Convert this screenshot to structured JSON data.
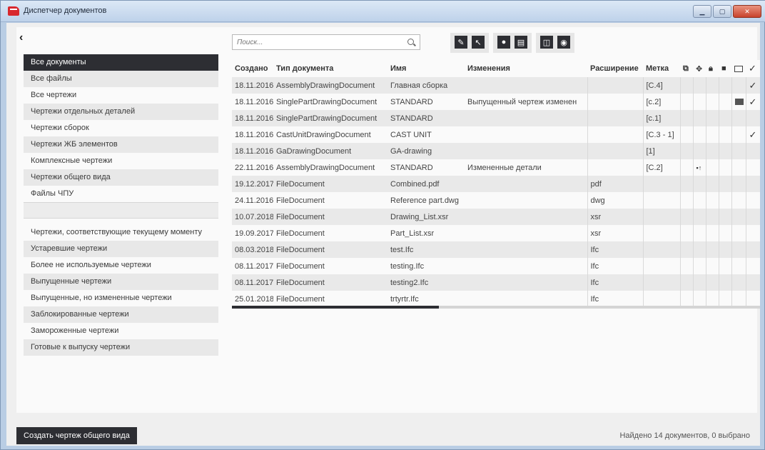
{
  "window": {
    "title": "Диспетчер документов"
  },
  "sidebar": {
    "back": "‹",
    "items_top": [
      "Все документы",
      "Все файлы",
      "Все чертежи",
      "Чертежи отдельных деталей",
      "Чертежи сборок",
      "Чертежи ЖБ элементов",
      "Комплексные чертежи",
      "Чертежи общего вида",
      "Файлы ЧПУ"
    ],
    "items_bottom": [
      "Чертежи, соответствующие текущему моменту",
      "Устаревшие чертежи",
      "Более не используемые чертежи",
      "Выпущенные чертежи",
      "Выпущенные, но измененные чертежи",
      "Заблокированные чертежи",
      "Замороженные чертежи",
      "Готовые к выпуску чертежи"
    ]
  },
  "search": {
    "placeholder": "Поиск..."
  },
  "table": {
    "headers": [
      "Создано",
      "Тип документа",
      "Имя",
      "Изменения",
      "Расширение",
      "Метка"
    ],
    "rows": [
      {
        "created": "18.11.2016",
        "type": "AssemblyDrawingDocument",
        "name": "Главная сборка",
        "changes": "",
        "ext": "",
        "mark": "[C.4]",
        "flag": "",
        "mail": false,
        "check": true
      },
      {
        "created": "18.11.2016",
        "type": "SinglePartDrawingDocument",
        "name": "STANDARD",
        "changes": "Выпущенный чертеж изменен",
        "ext": "",
        "mark": "[c.2]",
        "flag": "",
        "mail": true,
        "check": true
      },
      {
        "created": "18.11.2016",
        "type": "SinglePartDrawingDocument",
        "name": "STANDARD",
        "changes": "",
        "ext": "",
        "mark": "[c.1]",
        "flag": "",
        "mail": false,
        "check": false
      },
      {
        "created": "18.11.2016",
        "type": "CastUnitDrawingDocument",
        "name": "CAST UNIT",
        "changes": "",
        "ext": "",
        "mark": "[C.3 - 1]",
        "flag": "",
        "mail": false,
        "check": true
      },
      {
        "created": "18.11.2016",
        "type": "GaDrawingDocument",
        "name": "GA-drawing",
        "changes": "",
        "ext": "",
        "mark": "[1]",
        "flag": "",
        "mail": false,
        "check": false
      },
      {
        "created": "22.11.2016",
        "type": "AssemblyDrawingDocument",
        "name": "STANDARD",
        "changes": "Измененные детали",
        "ext": "",
        "mark": "[C.2]",
        "flag": "▪↑",
        "mail": false,
        "check": false
      },
      {
        "created": "19.12.2017",
        "type": "FileDocument",
        "name": "Combined.pdf",
        "changes": "",
        "ext": "pdf",
        "mark": "",
        "flag": "",
        "mail": false,
        "check": false
      },
      {
        "created": "24.11.2016",
        "type": "FileDocument",
        "name": "Reference part.dwg",
        "changes": "",
        "ext": "dwg",
        "mark": "",
        "flag": "",
        "mail": false,
        "check": false
      },
      {
        "created": "10.07.2018",
        "type": "FileDocument",
        "name": "Drawing_List.xsr",
        "changes": "",
        "ext": "xsr",
        "mark": "",
        "flag": "",
        "mail": false,
        "check": false
      },
      {
        "created": "19.09.2017",
        "type": "FileDocument",
        "name": "Part_List.xsr",
        "changes": "",
        "ext": "xsr",
        "mark": "",
        "flag": "",
        "mail": false,
        "check": false
      },
      {
        "created": "08.03.2018",
        "type": "FileDocument",
        "name": "test.Ifc",
        "changes": "",
        "ext": "Ifc",
        "mark": "",
        "flag": "",
        "mail": false,
        "check": false
      },
      {
        "created": "08.11.2017",
        "type": "FileDocument",
        "name": "testing.Ifc",
        "changes": "",
        "ext": "Ifc",
        "mark": "",
        "flag": "",
        "mail": false,
        "check": false
      },
      {
        "created": "08.11.2017",
        "type": "FileDocument",
        "name": "testing2.Ifc",
        "changes": "",
        "ext": "Ifc",
        "mark": "",
        "flag": "",
        "mail": false,
        "check": false
      },
      {
        "created": "25.01.2018",
        "type": "FileDocument",
        "name": "trtyrtr.Ifc",
        "changes": "",
        "ext": "Ifc",
        "mark": "",
        "flag": "",
        "mail": false,
        "check": false
      }
    ],
    "check_glyph": "✓"
  },
  "footer": {
    "create_button": "Создать чертеж общего вида",
    "status": "Найдено 14 документов, 0 выбрано"
  },
  "colors": {
    "dark": "#2d2e33",
    "row_alt": "#e9e9e9",
    "accent_close": "#c8422c"
  }
}
